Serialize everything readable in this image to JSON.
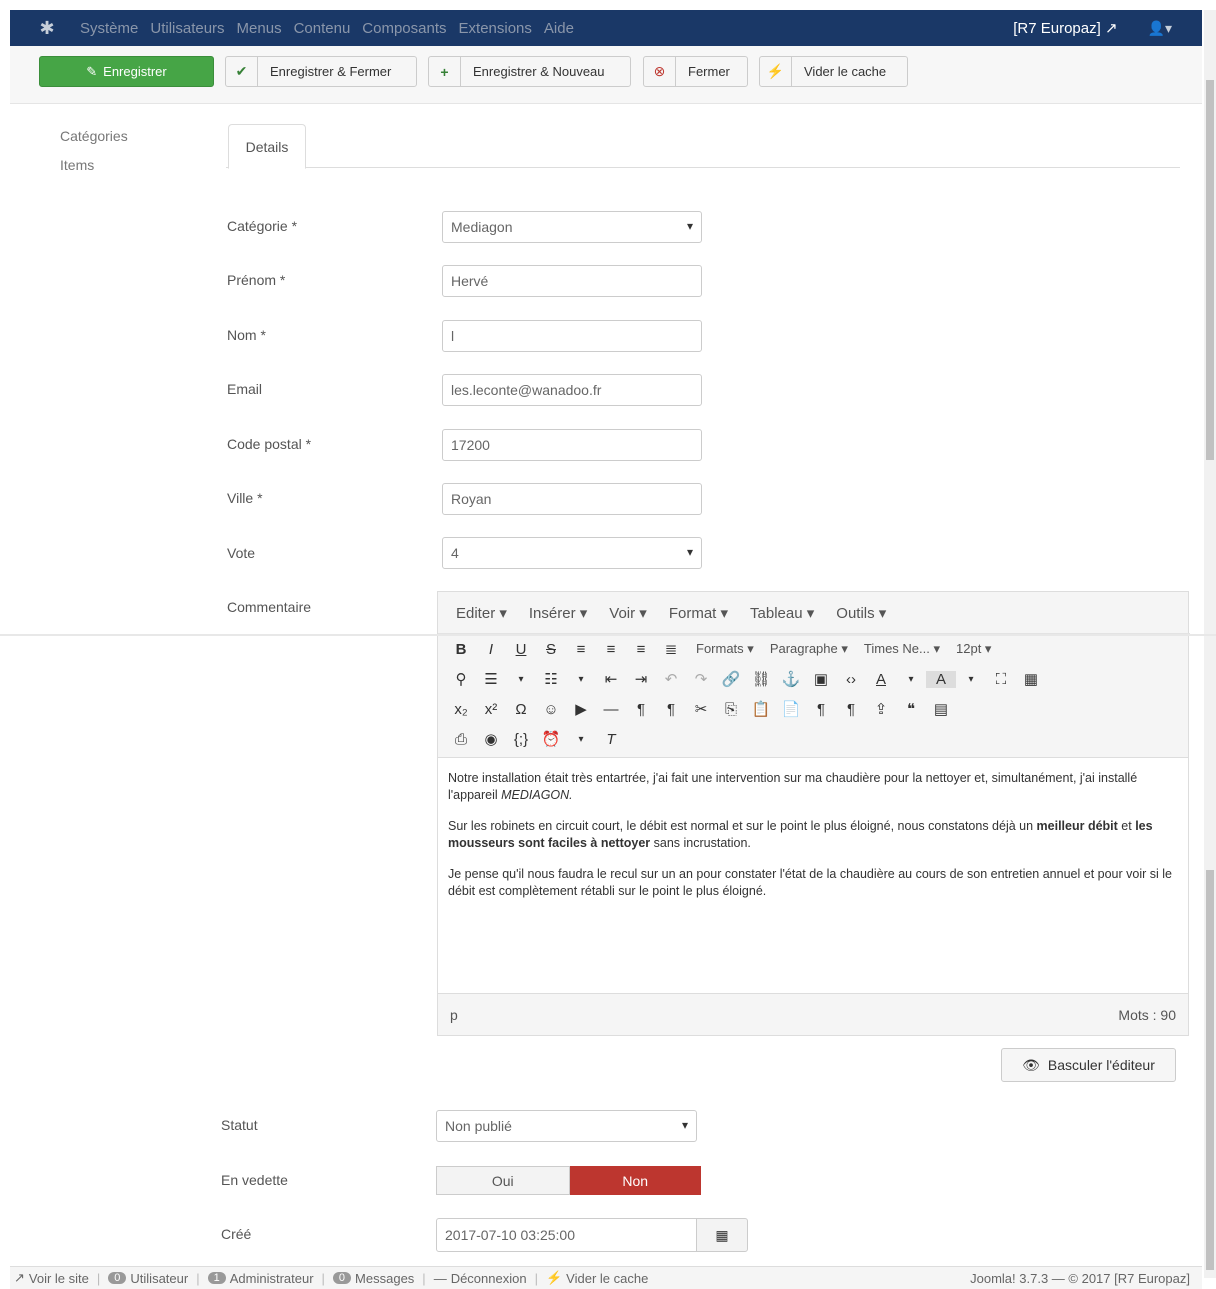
{
  "navbar": {
    "menu": [
      "Système",
      "Utilisateurs",
      "Menus",
      "Contenu",
      "Composants",
      "Extensions",
      "Aide"
    ],
    "site_name": "[R7 Europaz]",
    "external_icon": "external-link-icon",
    "user_icon": "user-icon"
  },
  "toolbar": {
    "save": "Enregistrer",
    "save_close": "Enregistrer & Fermer",
    "save_new": "Enregistrer & Nouveau",
    "close": "Fermer",
    "clear_cache": "Vider le cache"
  },
  "sidebar": {
    "items": [
      "Catégories",
      "Items"
    ]
  },
  "tabs": {
    "details": "Details"
  },
  "form": {
    "category": {
      "label": "Catégorie *",
      "value": "Mediagon"
    },
    "firstname": {
      "label": "Prénom *",
      "value": "Hervé"
    },
    "lastname": {
      "label": "Nom *",
      "value": "l"
    },
    "email": {
      "label": "Email",
      "value": "les.leconte@wanadoo.fr"
    },
    "postal_code": {
      "label": "Code postal *",
      "value": "17200"
    },
    "city": {
      "label": "Ville *",
      "value": "Royan"
    },
    "vote": {
      "label": "Vote",
      "value": "4"
    },
    "comment": {
      "label": "Commentaire"
    },
    "status": {
      "label": "Statut",
      "value": "Non publié"
    },
    "featured": {
      "label": "En vedette",
      "yes": "Oui",
      "no": "Non"
    },
    "created": {
      "label": "Créé",
      "value": "2017-07-10 03:25:00"
    }
  },
  "editor": {
    "menus": [
      "Editer ▾",
      "Insérer ▾",
      "Voir ▾",
      "Format ▾",
      "Tableau ▾",
      "Outils ▾"
    ],
    "formats": "Formats ▾",
    "paragraph": "Paragraphe ▾",
    "font": "Times Ne... ▾",
    "size": "12pt ▾",
    "paragraphs": {
      "p1a": "Notre installation était très entartrée, j'ai fait une intervention sur ma chaudière pour la nettoyer et, simultanément, j'ai installé l'appareil ",
      "p1b": "MEDIAGON.",
      "p2a": "Sur les robinets en circuit court, le débit est normal et sur le point le plus éloigné, nous constatons déjà un ",
      "p2b": "meilleur débit",
      "p2c": " et ",
      "p2d": "les mousseurs sont faciles à nettoyer",
      "p2e": " sans incrustation.",
      "p3": "Je pense qu'il nous faudra le recul sur un an pour constater l'état de la chaudière au cours de son entretien annuel et pour voir si le débit est complètement rétabli sur le point le plus éloigné."
    },
    "path": "p",
    "word_count": "Mots : 90",
    "toggle": "Basculer l'éditeur"
  },
  "footer": {
    "view_site": "Voir le site",
    "users_count": "0",
    "users": "Utilisateur",
    "admins_count": "1",
    "admins": "Administrateur",
    "messages_count": "0",
    "messages": "Messages",
    "logout": "Déconnexion",
    "clear_cache": "Vider le cache",
    "version": "Joomla! 3.7.3 — © 2017 [R7 Europaz]"
  }
}
